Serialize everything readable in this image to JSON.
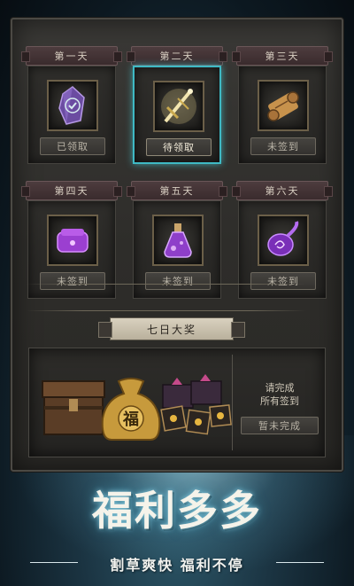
{
  "days": [
    {
      "label": "第一天",
      "status": "已领取",
      "icon": "purple-crystal-icon"
    },
    {
      "label": "第二天",
      "status": "待领取",
      "icon": "golden-sword-icon",
      "active": true
    },
    {
      "label": "第三天",
      "status": "未签到",
      "icon": "scroll-icon"
    },
    {
      "label": "第四天",
      "status": "未签到",
      "icon": "purple-pouch-icon"
    },
    {
      "label": "第五天",
      "status": "未签到",
      "icon": "potion-bottle-icon"
    },
    {
      "label": "第六天",
      "status": "未签到",
      "icon": "purple-sack-icon"
    }
  ],
  "grand_prize": {
    "title": "七日大奖",
    "hint_line1": "请完成",
    "hint_line2": "所有签到",
    "status": "暂未完成",
    "loot_bag_text": "福"
  },
  "promo": {
    "title": "福利多多",
    "subtitle": "割草爽快 福利不停"
  },
  "colors": {
    "active_glow": "#3fb9c4",
    "panel": "#2e2d2a",
    "banner": "#3a2b2d"
  }
}
